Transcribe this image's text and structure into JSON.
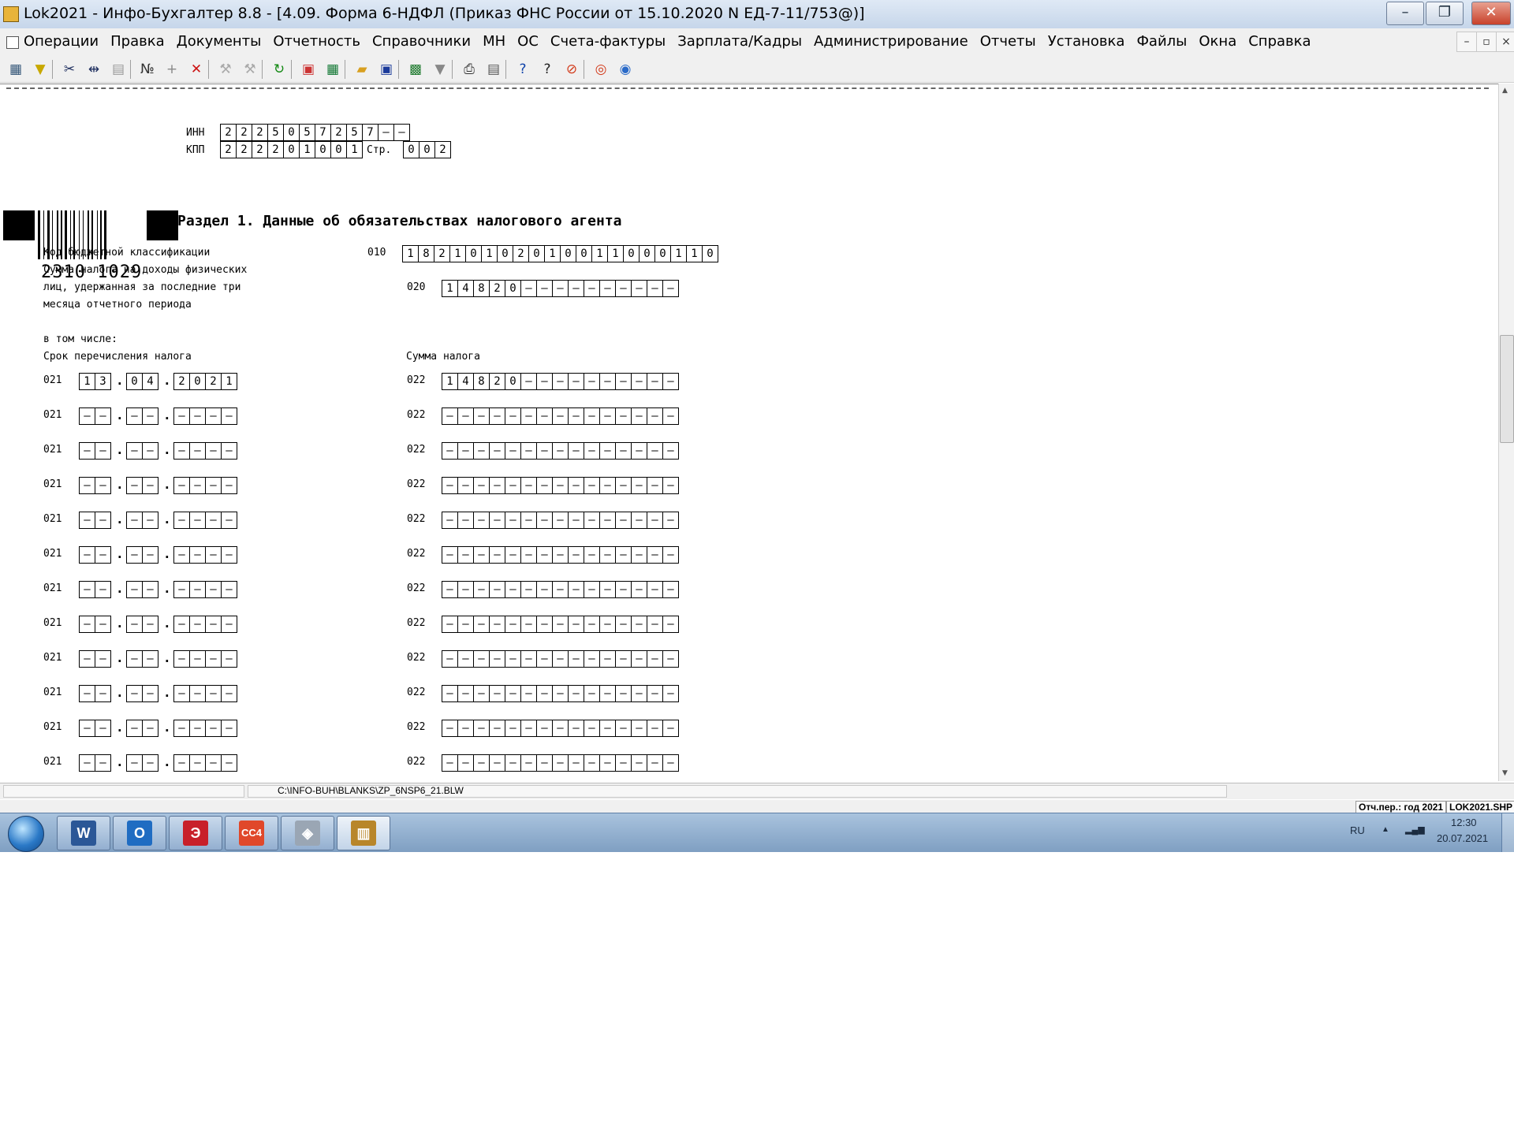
{
  "window": {
    "title": "Lok2021 - Инфо-Бухгалтер 8.8 - [4.09. Форма 6-НДФЛ (Приказ ФНС России от 15.10.2020 N ЕД-7-11/753@)]",
    "minimize": "–",
    "restore": "❐",
    "close": "✕"
  },
  "menu": [
    "Операции",
    "Правка",
    "Документы",
    "Отчетность",
    "Справочники",
    "МН",
    "ОС",
    "Счета-фактуры",
    "Зарплата/Кадры",
    "Администрирование",
    "Отчеты",
    "Установка",
    "Файлы",
    "Окна",
    "Справка"
  ],
  "mdi_buttons": [
    "–",
    "▫",
    "×"
  ],
  "toolbar": [
    {
      "icon": "grid-icon",
      "glyph": "▦",
      "color": "#335577"
    },
    {
      "icon": "filter-icon",
      "glyph": "▼",
      "color": "#c8a800"
    },
    {
      "icon": "cut-icon",
      "glyph": "✂",
      "color": "#203060"
    },
    {
      "icon": "split-icon",
      "glyph": "⇹",
      "color": "#203060"
    },
    {
      "icon": "paste-icon",
      "glyph": "▤",
      "color": "#999999"
    },
    {
      "icon": "number-icon",
      "glyph": "№",
      "color": "#333333"
    },
    {
      "icon": "add-icon",
      "glyph": "+",
      "color": "#888888"
    },
    {
      "icon": "delete-icon",
      "glyph": "✕",
      "color": "#cc1111"
    },
    {
      "icon": "tool1-icon",
      "glyph": "⚒",
      "color": "#aaaaaa"
    },
    {
      "icon": "tool2-icon",
      "glyph": "⚒",
      "color": "#aaaaaa"
    },
    {
      "icon": "refresh-icon",
      "glyph": "↻",
      "color": "#118811"
    },
    {
      "icon": "calendar-icon",
      "glyph": "▣",
      "color": "#cc3333"
    },
    {
      "icon": "calculator-icon",
      "glyph": "▦",
      "color": "#117733"
    },
    {
      "icon": "open-folder-icon",
      "glyph": "▰",
      "color": "#d8a020"
    },
    {
      "icon": "save-icon",
      "glyph": "▣",
      "color": "#1a3a9a"
    },
    {
      "icon": "excel-icon",
      "glyph": "▩",
      "color": "#1e7a2e"
    },
    {
      "icon": "word-export-icon",
      "glyph": "▼",
      "color": "#888888"
    },
    {
      "icon": "print-icon",
      "glyph": "⎙",
      "color": "#333333"
    },
    {
      "icon": "preview-icon",
      "glyph": "▤",
      "color": "#555555"
    },
    {
      "icon": "help-icon",
      "glyph": "?",
      "color": "#1144aa"
    },
    {
      "icon": "context-help-icon",
      "glyph": "?",
      "color": "#222222"
    },
    {
      "icon": "compass-icon",
      "glyph": "⊘",
      "color": "#d23a1a"
    },
    {
      "icon": "lifebuoy-icon",
      "glyph": "◎",
      "color": "#d23a1a"
    },
    {
      "icon": "web-icon",
      "glyph": "◉",
      "color": "#2a6ac8"
    }
  ],
  "form": {
    "inn_label": "ИНН",
    "inn": [
      "2",
      "2",
      "2",
      "5",
      "0",
      "5",
      "7",
      "2",
      "5",
      "7",
      "–",
      "–"
    ],
    "kpp_label": "КПП",
    "kpp": [
      "2",
      "2",
      "2",
      "2",
      "0",
      "1",
      "0",
      "0",
      "1"
    ],
    "page_label": "Стр.",
    "page": [
      "0",
      "0",
      "2"
    ],
    "barcode_number": "2310 1029",
    "section_title": "Раздел 1. Данные об обязательствах налогового агента",
    "kbk_label": "Код бюджетной классификации",
    "kbk_code": "010",
    "kbk": [
      "1",
      "8",
      "2",
      "1",
      "0",
      "1",
      "0",
      "2",
      "0",
      "1",
      "0",
      "0",
      "1",
      "1",
      "0",
      "0",
      "0",
      "1",
      "1",
      "0"
    ],
    "tax_label_1": "Сумма налога на доходы физических",
    "tax_label_2": "лиц, удержанная за последние три",
    "tax_label_3": "месяца отчетного периода",
    "tax_code": "020",
    "tax_sum": [
      "1",
      "4",
      "8",
      "2",
      "0",
      "–",
      "–",
      "–",
      "–",
      "–",
      "–",
      "–",
      "–",
      "–",
      "–"
    ],
    "including_label": "в том числе:",
    "deadline_header": "Срок перечисления налога",
    "amount_header": "Сумма налога",
    "rows": [
      {
        "date_code": "021",
        "day": [
          "1",
          "3"
        ],
        "month": [
          "0",
          "4"
        ],
        "year": [
          "2",
          "0",
          "2",
          "1"
        ],
        "sum_code": "022",
        "sum": [
          "1",
          "4",
          "8",
          "2",
          "0",
          "–",
          "–",
          "–",
          "–",
          "–",
          "–",
          "–",
          "–",
          "–",
          "–"
        ]
      },
      {
        "date_code": "021",
        "day": [
          "–",
          "–"
        ],
        "month": [
          "–",
          "–"
        ],
        "year": [
          "–",
          "–",
          "–",
          "–"
        ],
        "sum_code": "022",
        "sum": [
          "–",
          "–",
          "–",
          "–",
          "–",
          "–",
          "–",
          "–",
          "–",
          "–",
          "–",
          "–",
          "–",
          "–",
          "–"
        ]
      },
      {
        "date_code": "021",
        "day": [
          "–",
          "–"
        ],
        "month": [
          "–",
          "–"
        ],
        "year": [
          "–",
          "–",
          "–",
          "–"
        ],
        "sum_code": "022",
        "sum": [
          "–",
          "–",
          "–",
          "–",
          "–",
          "–",
          "–",
          "–",
          "–",
          "–",
          "–",
          "–",
          "–",
          "–",
          "–"
        ]
      },
      {
        "date_code": "021",
        "day": [
          "–",
          "–"
        ],
        "month": [
          "–",
          "–"
        ],
        "year": [
          "–",
          "–",
          "–",
          "–"
        ],
        "sum_code": "022",
        "sum": [
          "–",
          "–",
          "–",
          "–",
          "–",
          "–",
          "–",
          "–",
          "–",
          "–",
          "–",
          "–",
          "–",
          "–",
          "–"
        ]
      },
      {
        "date_code": "021",
        "day": [
          "–",
          "–"
        ],
        "month": [
          "–",
          "–"
        ],
        "year": [
          "–",
          "–",
          "–",
          "–"
        ],
        "sum_code": "022",
        "sum": [
          "–",
          "–",
          "–",
          "–",
          "–",
          "–",
          "–",
          "–",
          "–",
          "–",
          "–",
          "–",
          "–",
          "–",
          "–"
        ]
      },
      {
        "date_code": "021",
        "day": [
          "–",
          "–"
        ],
        "month": [
          "–",
          "–"
        ],
        "year": [
          "–",
          "–",
          "–",
          "–"
        ],
        "sum_code": "022",
        "sum": [
          "–",
          "–",
          "–",
          "–",
          "–",
          "–",
          "–",
          "–",
          "–",
          "–",
          "–",
          "–",
          "–",
          "–",
          "–"
        ]
      },
      {
        "date_code": "021",
        "day": [
          "–",
          "–"
        ],
        "month": [
          "–",
          "–"
        ],
        "year": [
          "–",
          "–",
          "–",
          "–"
        ],
        "sum_code": "022",
        "sum": [
          "–",
          "–",
          "–",
          "–",
          "–",
          "–",
          "–",
          "–",
          "–",
          "–",
          "–",
          "–",
          "–",
          "–",
          "–"
        ]
      },
      {
        "date_code": "021",
        "day": [
          "–",
          "–"
        ],
        "month": [
          "–",
          "–"
        ],
        "year": [
          "–",
          "–",
          "–",
          "–"
        ],
        "sum_code": "022",
        "sum": [
          "–",
          "–",
          "–",
          "–",
          "–",
          "–",
          "–",
          "–",
          "–",
          "–",
          "–",
          "–",
          "–",
          "–",
          "–"
        ]
      },
      {
        "date_code": "021",
        "day": [
          "–",
          "–"
        ],
        "month": [
          "–",
          "–"
        ],
        "year": [
          "–",
          "–",
          "–",
          "–"
        ],
        "sum_code": "022",
        "sum": [
          "–",
          "–",
          "–",
          "–",
          "–",
          "–",
          "–",
          "–",
          "–",
          "–",
          "–",
          "–",
          "–",
          "–",
          "–"
        ]
      },
      {
        "date_code": "021",
        "day": [
          "–",
          "–"
        ],
        "month": [
          "–",
          "–"
        ],
        "year": [
          "–",
          "–",
          "–",
          "–"
        ],
        "sum_code": "022",
        "sum": [
          "–",
          "–",
          "–",
          "–",
          "–",
          "–",
          "–",
          "–",
          "–",
          "–",
          "–",
          "–",
          "–",
          "–",
          "–"
        ]
      },
      {
        "date_code": "021",
        "day": [
          "–",
          "–"
        ],
        "month": [
          "–",
          "–"
        ],
        "year": [
          "–",
          "–",
          "–",
          "–"
        ],
        "sum_code": "022",
        "sum": [
          "–",
          "–",
          "–",
          "–",
          "–",
          "–",
          "–",
          "–",
          "–",
          "–",
          "–",
          "–",
          "–",
          "–",
          "–"
        ]
      },
      {
        "date_code": "021",
        "day": [
          "–",
          "–"
        ],
        "month": [
          "–",
          "–"
        ],
        "year": [
          "–",
          "–",
          "–",
          "–"
        ],
        "sum_code": "022",
        "sum": [
          "–",
          "–",
          "–",
          "–",
          "–",
          "–",
          "–",
          "–",
          "–",
          "–",
          "–",
          "–",
          "–",
          "–",
          "–"
        ]
      }
    ]
  },
  "status": {
    "file_path": "C:\\INFO-BUH\\BLANKS\\ZP_6NSP6_21.BLW",
    "period": "Отч.пер.: год 2021",
    "shp": "LOK2021.SHP"
  },
  "taskbar": {
    "apps": [
      {
        "icon": "word-icon",
        "glyph": "W",
        "bg": "#2b5797"
      },
      {
        "icon": "outlook-icon",
        "glyph": "O",
        "bg": "#1f6cc2"
      },
      {
        "icon": "e-icon",
        "glyph": "Э",
        "bg": "#c8202a"
      },
      {
        "icon": "cc4-icon",
        "glyph": "CC4",
        "bg": "#e0482a"
      },
      {
        "icon": "scanner-icon",
        "glyph": "◈",
        "bg": "#9aa6b4"
      },
      {
        "icon": "abacus-icon",
        "glyph": "▥",
        "bg": "#b8862a"
      }
    ],
    "lang": "RU",
    "tray_arrow": "▲",
    "signal": "▂▄▆",
    "time": "12:30",
    "date": "20.07.2021"
  }
}
